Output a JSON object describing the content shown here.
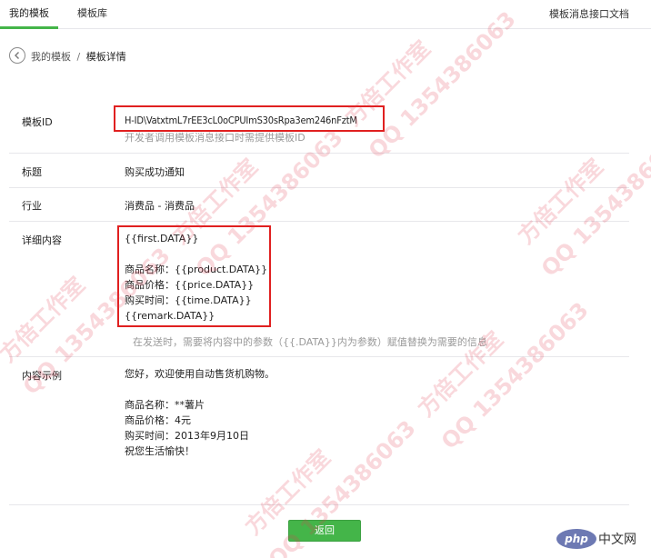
{
  "tabs": [
    {
      "label": "我的模板",
      "active": true
    },
    {
      "label": "模板库",
      "active": false
    }
  ],
  "doc_link": "模板消息接口文档",
  "breadcrumb": {
    "parent": "我的模板",
    "separator": "/",
    "current": "模板详情"
  },
  "rows": {
    "template_id": {
      "label": "模板ID",
      "value": "H-ID\\VatxtmL7rEE3cL0oCPUImS30sRpa3em246nFztM",
      "hint": "开发者调用模板消息接口时需提供模板ID"
    },
    "title": {
      "label": "标题",
      "value": "购买成功通知"
    },
    "industry": {
      "label": "行业",
      "value": "消费品 - 消费品"
    },
    "content": {
      "label": "详细内容",
      "lines": [
        "{{first.DATA}}",
        "",
        "商品名称：{{product.DATA}}",
        "商品价格：{{price.DATA}}",
        "购买时间：{{time.DATA}}",
        "{{remark.DATA}}"
      ],
      "hint": "在发送时，需要将内容中的参数（{{.DATA}}内为参数）赋值替换为需要的信息"
    },
    "example": {
      "label": "内容示例",
      "lines": [
        "您好，欢迎使用自动售货机购物。",
        "",
        "商品名称：**薯片",
        "商品价格：4元",
        "购买时间：2013年9月10日",
        "祝您生活愉快！"
      ]
    }
  },
  "return_button": "返回",
  "watermark": {
    "name": "方倍工作室",
    "qq": "QQ 1354386063"
  },
  "logo": {
    "badge": "php",
    "text": "中文网"
  },
  "colors": {
    "accent": "#44b549",
    "highlight": "#e02020",
    "hint": "#9a9a9a",
    "border": "#e7e7eb"
  }
}
